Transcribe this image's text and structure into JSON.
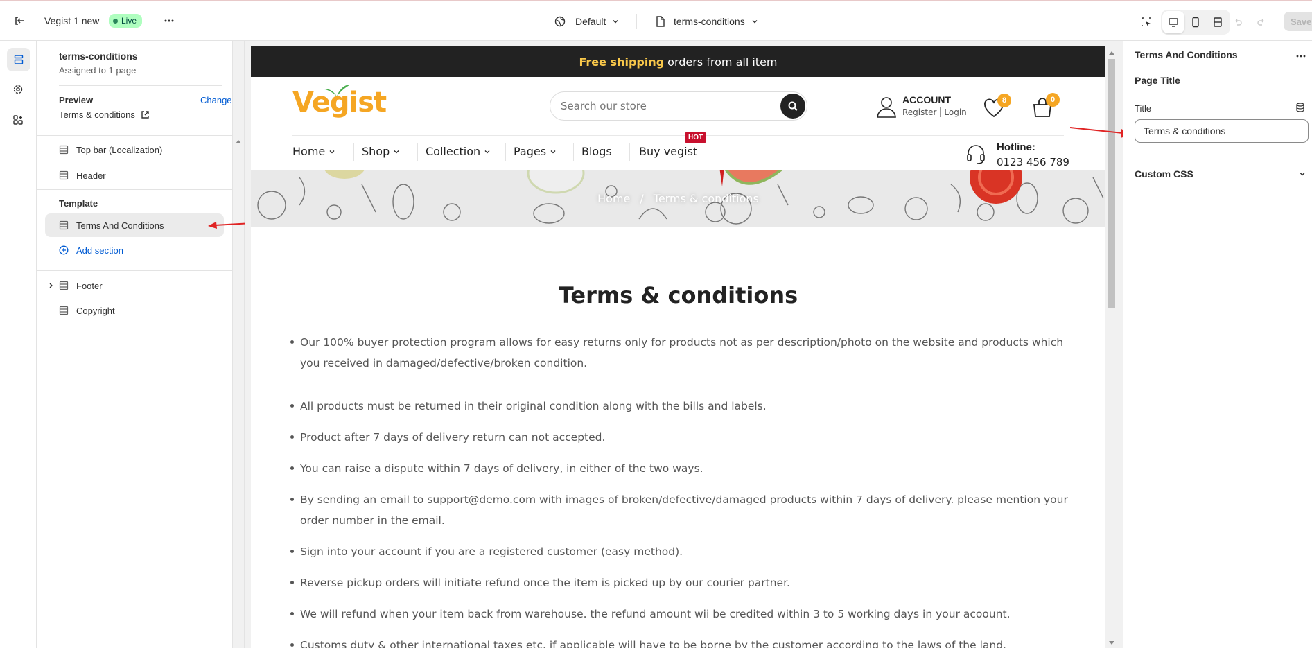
{
  "topbar": {
    "store_name": "Vegist 1 new",
    "status": "Live",
    "theme_selector": "Default",
    "page_selector": "terms-conditions",
    "save_label": "Save"
  },
  "left": {
    "template_name": "terms-conditions",
    "assigned": "Assigned to 1 page",
    "preview_label": "Preview",
    "change_label": "Change",
    "preview_page": "Terms & conditions",
    "header_sections": [
      "Top bar (Localization)",
      "Header"
    ],
    "template_label": "Template",
    "template_section": "Terms And Conditions",
    "add_section": "Add section",
    "footer_sections": [
      "Footer",
      "Copyright"
    ]
  },
  "store": {
    "announce_bold": "Free shipping",
    "announce_rest": "orders from all item",
    "logo": "Vegist",
    "search_placeholder": "Search our store",
    "account_title": "ACCOUNT",
    "register": "Register",
    "login": "Login",
    "wishlist_count": "8",
    "cart_count": "0",
    "nav": [
      "Home",
      "Shop",
      "Collection",
      "Pages",
      "Blogs",
      "Buy vegist"
    ],
    "hot_badge": "HOT",
    "hotline_label": "Hotline:",
    "hotline_number": "0123 456 789",
    "breadcrumb_home": "Home",
    "breadcrumb_sep": "/",
    "breadcrumb_current": "Terms & conditions",
    "page_heading": "Terms & conditions",
    "bullets": [
      "Our 100% buyer protection program allows for easy returns only for products not as per description/photo on the website and products which you received in damaged/defective/broken condition.",
      "All products must be returned in their original condition along with the bills and labels.",
      "Product after 7 days of delivery return can not accepted.",
      "You can raise a dispute within 7 days of delivery, in either of the two ways.",
      "By sending an email to support@demo.com with images of broken/defective/damaged products within 7 days of delivery. please mention your order number in the email.",
      "Sign into your account if you are a registered customer (easy method).",
      "Reverse pickup orders will initiate refund once the item is picked up by our courier partner.",
      "We will refund when your item back from warehouse. the refund amount wii be credited within 3 to 5 working days in your acoount.",
      "Customs duty & other international taxes etc. if applicable will have to be borne by the customer according to the laws of the land."
    ]
  },
  "right": {
    "section_title": "Terms And Conditions",
    "group_title": "Page Title",
    "field_label": "Title",
    "field_value": "Terms & conditions",
    "custom_css": "Custom CSS"
  },
  "colors": {
    "accent_blue": "#005bd3",
    "live_green": "#affebf",
    "logo_orange": "#f5a623",
    "logo_green": "#4caf50",
    "arrow_red": "#e02424"
  }
}
